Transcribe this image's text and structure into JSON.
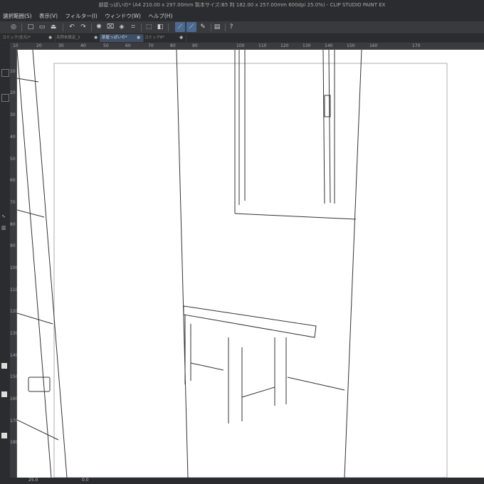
{
  "window": {
    "title": "部屋っぽいの* (A4 210.00 x 297.00mm 製本サイズ:B5 判 182.00 x 257.00mm 600dpi 25.0%)  - CLIP STUDIO PAINT EX"
  },
  "menu": [
    "選択範囲(S)",
    "表示(V)",
    "フィルター(I)",
    "ウィンドウ(W)",
    "ヘルプ(H)"
  ],
  "toolbar": {
    "icons": [
      "app-icon",
      "new-file-icon",
      "open-file-icon",
      "save-icon",
      "undo-icon",
      "redo-icon",
      "transform-icon",
      "clear-icon",
      "fill-icon",
      "crop-icon",
      "select-icon",
      "select-icon-2",
      "snap-ruler-icon",
      "snap-special-icon",
      "pen-pressure-icon",
      "layer-icon",
      "help-icon"
    ]
  },
  "tabs": [
    {
      "label": "コミック(全元)*",
      "active": false
    },
    {
      "label": "名称未設定_1",
      "active": false
    },
    {
      "label": "部屋っぽいの*",
      "active": true
    },
    {
      "label": "コミック8*",
      "active": false
    }
  ],
  "ruler_top": [
    "10",
    "20",
    "30",
    "40",
    "50",
    "60",
    "70",
    "80",
    "90",
    "100",
    "110",
    "120",
    "130",
    "140",
    "150",
    "160",
    "170"
  ],
  "ruler_left": [
    "10",
    "20",
    "30",
    "40",
    "50",
    "60",
    "70",
    "80",
    "90",
    "100",
    "110",
    "120",
    "130",
    "140",
    "150",
    "160",
    "170",
    "180"
  ],
  "statusbar": {
    "zoom": "25.0",
    "angle": "0.0"
  }
}
